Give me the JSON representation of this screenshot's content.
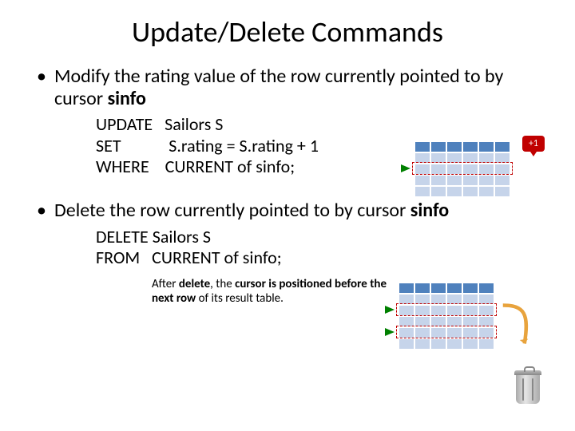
{
  "title": "Update/Delete Commands",
  "bullet1_pre": "Modify the rating value of the row currently pointed to by cursor ",
  "bullet1_bold": "sinfo",
  "code1": "UPDATE   Sailors S\nSET            S.rating = S.rating + 1\nWHERE    CURRENT of sinfo;",
  "bubble_text": "+1",
  "bullet2_pre": "Delete the row currently pointed to by cursor ",
  "bullet2_bold": "sinfo",
  "code2": "DELETE Sailors S\nFROM   CURRENT of sinfo;",
  "note_pre": "After ",
  "note_bold1": "delete",
  "note_mid": ", the ",
  "note_bold2": "cursor is positioned before the next row",
  "note_post": " of its result table."
}
